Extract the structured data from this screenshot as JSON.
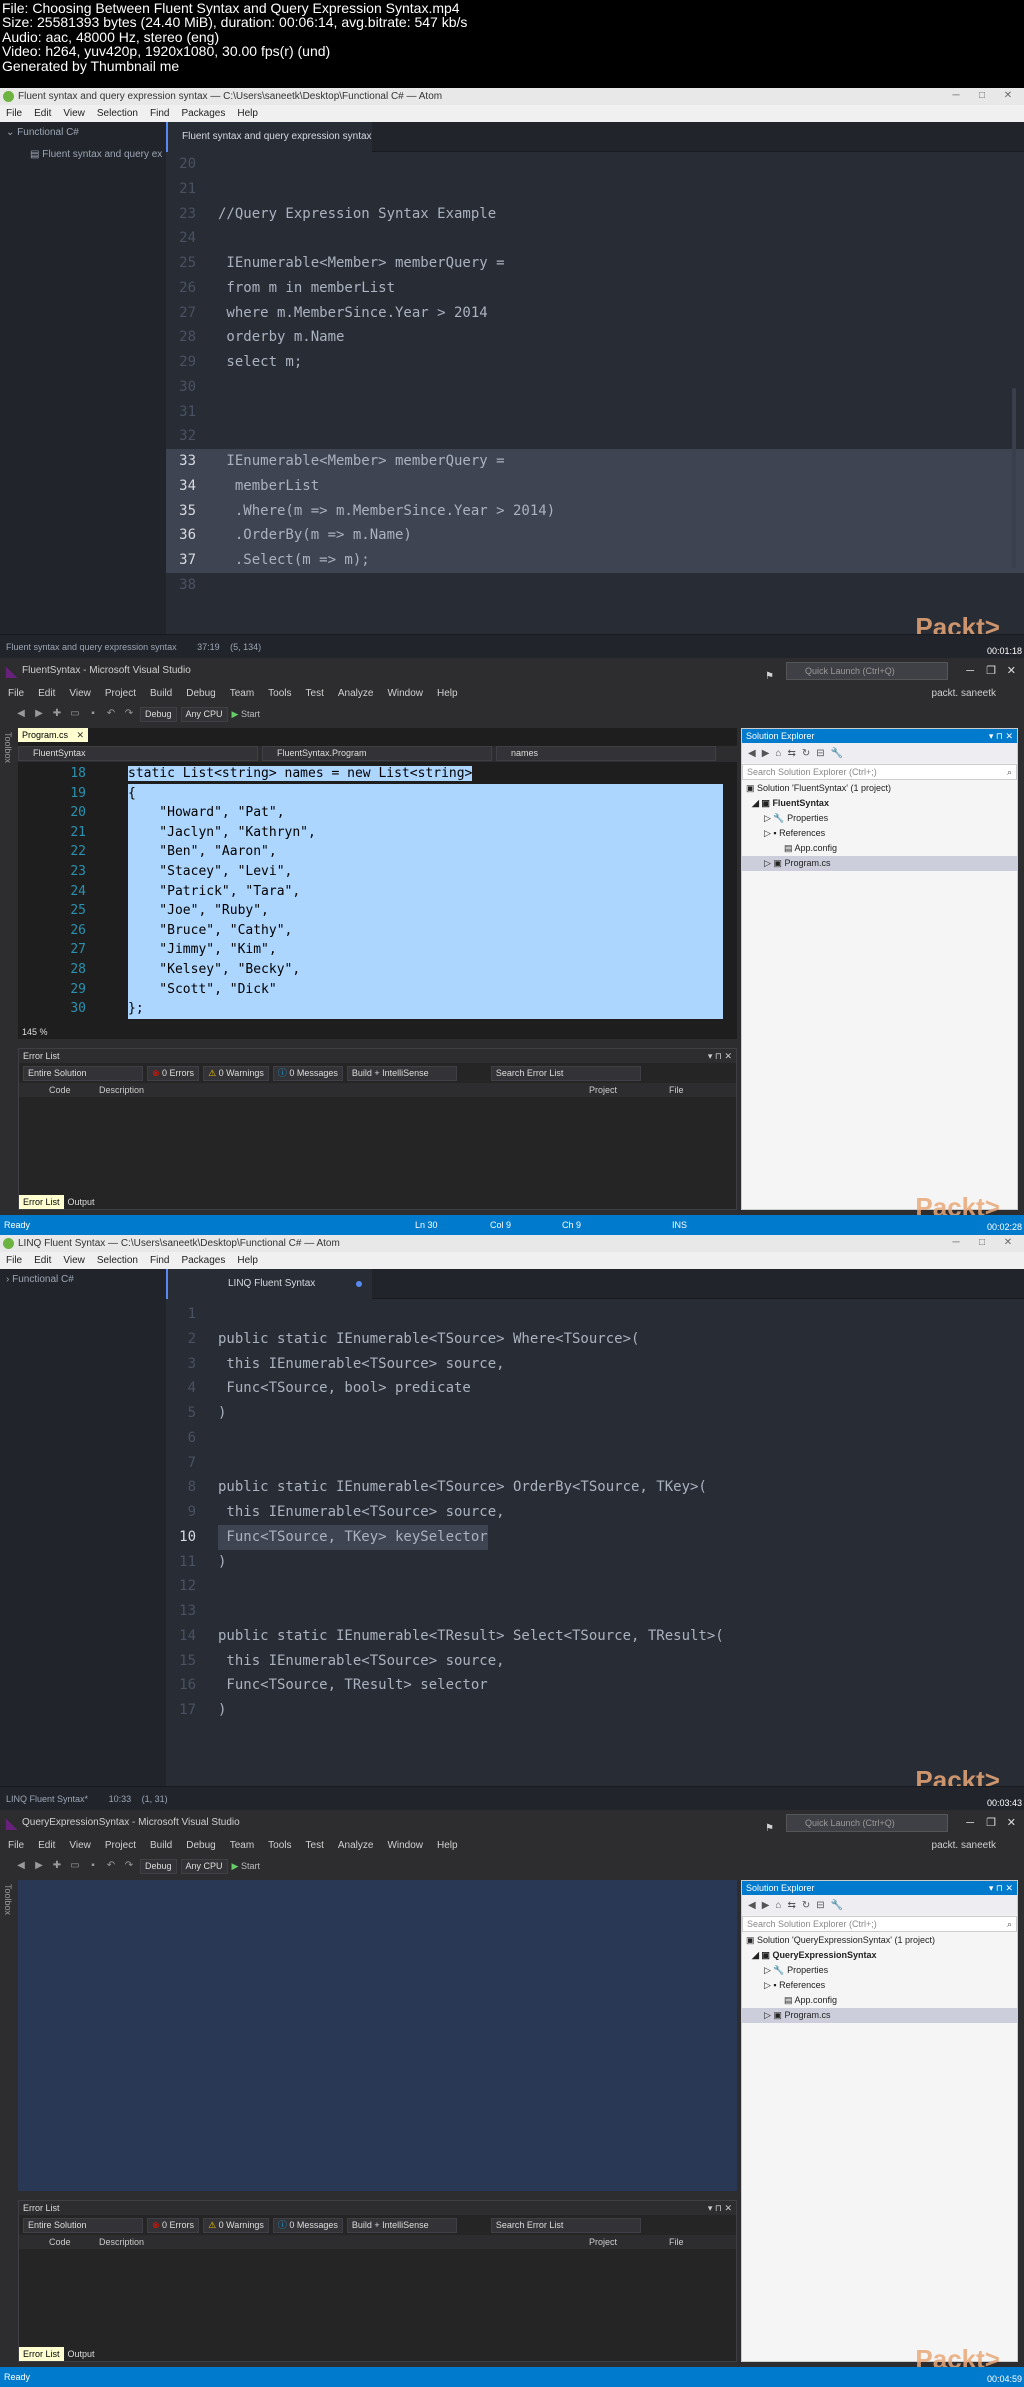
{
  "header": {
    "lines": [
      "File: Choosing Between Fluent Syntax and Query Expression Syntax.mp4",
      "Size: 25581393 bytes (24.40 MiB), duration: 00:06:14, avg.bitrate: 547 kb/s",
      "Audio: aac, 48000 Hz, stereo (eng)",
      "Video: h264, yuv420p, 1920x1080, 30.00 fps(r) (und)",
      "Generated by Thumbnail me"
    ]
  },
  "watermark": "Packt>",
  "frame1": {
    "title": "Fluent syntax and query expression syntax — C:\\Users\\saneetk\\Desktop\\Functional C# — Atom",
    "menu": [
      "File",
      "Edit",
      "View",
      "Selection",
      "Find",
      "Packages",
      "Help"
    ],
    "tree_root": "Functional C#",
    "tree_file": "Fluent syntax and query ex",
    "tab": "Fluent syntax and query expression syntax",
    "status_file": "Fluent syntax and query expression syntax",
    "status_pos": "37:19",
    "status_sel": "(5, 134)",
    "timestamp": "00:01:18",
    "lines": [
      {
        "n": "20",
        "t": ""
      },
      {
        "n": "21",
        "t": ""
      },
      {
        "n": "23",
        "t": "//Query Expression Syntax Example"
      },
      {
        "n": "24",
        "t": ""
      },
      {
        "n": "25",
        "t": " IEnumerable<Member> memberQuery ="
      },
      {
        "n": "26",
        "t": " from m in memberList"
      },
      {
        "n": "27",
        "t": " where m.MemberSince.Year > 2014"
      },
      {
        "n": "28",
        "t": " orderby m.Name"
      },
      {
        "n": "29",
        "t": " select m;"
      },
      {
        "n": "30",
        "t": ""
      },
      {
        "n": "31",
        "t": ""
      },
      {
        "n": "32",
        "t": ""
      },
      {
        "n": "33",
        "t": " IEnumerable<Member> memberQuery ="
      },
      {
        "n": "34",
        "t": "  memberList"
      },
      {
        "n": "35",
        "t": "  .Where(m => m.MemberSince.Year > 2014)"
      },
      {
        "n": "36",
        "t": "  .OrderBy(m => m.Name)"
      },
      {
        "n": "37",
        "t": "  .Select(m => m);"
      },
      {
        "n": "38",
        "t": ""
      }
    ]
  },
  "frame2": {
    "title": "FluentSyntax - Microsoft Visual Studio",
    "quick_launch": "Quick Launch (Ctrl+Q)",
    "menu": [
      "File",
      "Edit",
      "View",
      "Project",
      "Build",
      "Debug",
      "Team",
      "Tools",
      "Test",
      "Analyze",
      "Window",
      "Help"
    ],
    "user": "packt. saneetk",
    "config": "Debug",
    "platform": "Any CPU",
    "start": "Start",
    "doc_tab": "Program.cs",
    "nav_project": "FluentSyntax",
    "nav_class": "FluentSyntax.Program",
    "nav_member": "names",
    "zoom": "145 %",
    "lines": [
      {
        "n": "18",
        "t": "static List<string> names = new List<string>"
      },
      {
        "n": "19",
        "t": "{"
      },
      {
        "n": "20",
        "t": "    \"Howard\", \"Pat\","
      },
      {
        "n": "21",
        "t": "    \"Jaclyn\", \"Kathryn\","
      },
      {
        "n": "22",
        "t": "    \"Ben\", \"Aaron\","
      },
      {
        "n": "23",
        "t": "    \"Stacey\", \"Levi\","
      },
      {
        "n": "24",
        "t": "    \"Patrick\", \"Tara\","
      },
      {
        "n": "25",
        "t": "    \"Joe\", \"Ruby\","
      },
      {
        "n": "26",
        "t": "    \"Bruce\", \"Cathy\","
      },
      {
        "n": "27",
        "t": "    \"Jimmy\", \"Kim\","
      },
      {
        "n": "28",
        "t": "    \"Kelsey\", \"Becky\","
      },
      {
        "n": "29",
        "t": "    \"Scott\", \"Dick\""
      },
      {
        "n": "30",
        "t": "};"
      }
    ],
    "errlist": {
      "title": "Error List",
      "scope": "Entire Solution",
      "errors": "0 Errors",
      "warnings": "0 Warnings",
      "messages": "0 Messages",
      "build": "Build + IntelliSense",
      "search": "Search Error List",
      "col_code": "Code",
      "col_desc": "Description",
      "col_project": "Project",
      "col_file": "File",
      "tab_errlist": "Error List",
      "tab_output": "Output"
    },
    "sol": {
      "title": "Solution Explorer",
      "search": "Search Solution Explorer (Ctrl+;)",
      "solution": "Solution 'FluentSyntax' (1 project)",
      "project": "FluentSyntax",
      "properties": "Properties",
      "references": "References",
      "appconfig": "App.config",
      "program": "Program.cs"
    },
    "status": {
      "ready": "Ready",
      "ln": "Ln 30",
      "col": "Col 9",
      "ch": "Ch 9",
      "ins": "INS"
    },
    "timestamp": "00:02:28"
  },
  "frame3": {
    "title": "LINQ Fluent Syntax — C:\\Users\\saneetk\\Desktop\\Functional C# — Atom",
    "menu": [
      "File",
      "Edit",
      "View",
      "Selection",
      "Find",
      "Packages",
      "Help"
    ],
    "tree_root": "Functional C#",
    "tab": "LINQ Fluent Syntax",
    "status_file": "LINQ Fluent Syntax*",
    "status_pos": "10:33",
    "status_sel": "(1, 31)",
    "timestamp": "00:03:43",
    "lines": [
      {
        "n": "1",
        "t": ""
      },
      {
        "n": "2",
        "t": "public static IEnumerable<TSource> Where<TSource>("
      },
      {
        "n": "3",
        "t": " this IEnumerable<TSource> source,"
      },
      {
        "n": "4",
        "t": " Func<TSource, bool> predicate"
      },
      {
        "n": "5",
        "t": ")"
      },
      {
        "n": "6",
        "t": ""
      },
      {
        "n": "7",
        "t": ""
      },
      {
        "n": "8",
        "t": "public static IEnumerable<TSource> OrderBy<TSource, TKey>("
      },
      {
        "n": "9",
        "t": " this IEnumerable<TSource> source,"
      },
      {
        "n": "10",
        "t": " Func<TSource, TKey> keySelector"
      },
      {
        "n": "11",
        "t": ")"
      },
      {
        "n": "12",
        "t": ""
      },
      {
        "n": "13",
        "t": ""
      },
      {
        "n": "14",
        "t": "public static IEnumerable<TResult> Select<TSource, TResult>("
      },
      {
        "n": "15",
        "t": " this IEnumerable<TSource> source,"
      },
      {
        "n": "16",
        "t": " Func<TSource, TResult> selector"
      },
      {
        "n": "17",
        "t": ")"
      }
    ]
  },
  "frame4": {
    "title": "QueryExpressionSyntax - Microsoft Visual Studio",
    "sol_solution": "Solution 'QueryExpressionSyntax' (1 project)",
    "sol_project": "QueryExpressionSyntax",
    "status_ready": "Ready",
    "timestamp": "00:04:59"
  },
  "colors": {
    "atom_bg": "#282c34",
    "vs_accent": "#007acc",
    "selection": "#add6ff",
    "packt": "#e9a878"
  }
}
